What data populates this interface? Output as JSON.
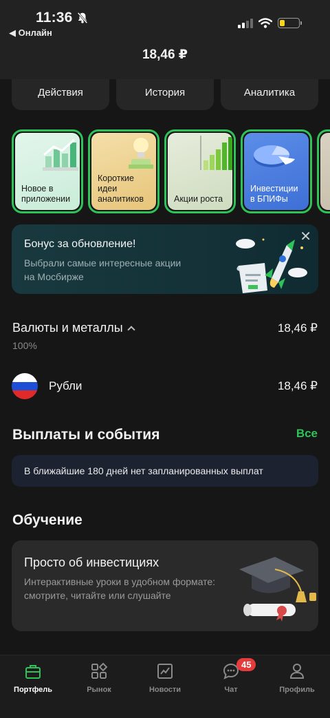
{
  "status_bar": {
    "time": "11:36",
    "back_app": "◀ Онлайн"
  },
  "header": {
    "amount": "18,46 ₽"
  },
  "actions": [
    {
      "label": "Действия"
    },
    {
      "label": "История"
    },
    {
      "label": "Аналитика"
    }
  ],
  "stories": [
    {
      "label": "Новое в приложении"
    },
    {
      "label": "Короткие идеи аналитиков"
    },
    {
      "label": "Акции роста"
    },
    {
      "label": "Инвестиции в БПИФы"
    }
  ],
  "bonus": {
    "title": "Бонус за обновление!",
    "text": "Выбрали самые интересные акции на Мосбирже",
    "close": "✕"
  },
  "currencies": {
    "title": "Валюты и металлы",
    "amount": "18,46 ₽",
    "percent": "100%",
    "items": [
      {
        "label": "Рубли",
        "amount": "18,46 ₽"
      }
    ]
  },
  "payouts": {
    "title": "Выплаты и события",
    "all_link": "Все",
    "message": "В ближайшие 180 дней нет запланированных выплат"
  },
  "learning": {
    "title": "Обучение",
    "card_title": "Просто об инвестициях",
    "card_text": "Интерактивные уроки в удобном формате: смотрите, читайте или слушайте"
  },
  "bottom_nav": [
    {
      "label": "Портфель",
      "icon": "briefcase-icon",
      "active": true
    },
    {
      "label": "Рынок",
      "icon": "market-grid-icon"
    },
    {
      "label": "Новости",
      "icon": "news-chart-icon"
    },
    {
      "label": "Чат",
      "icon": "chat-icon",
      "badge": "45"
    },
    {
      "label": "Профиль",
      "icon": "profile-icon"
    }
  ],
  "colors": {
    "accent": "#2fc259",
    "background": "#161616",
    "badge": "#e53b3b"
  }
}
